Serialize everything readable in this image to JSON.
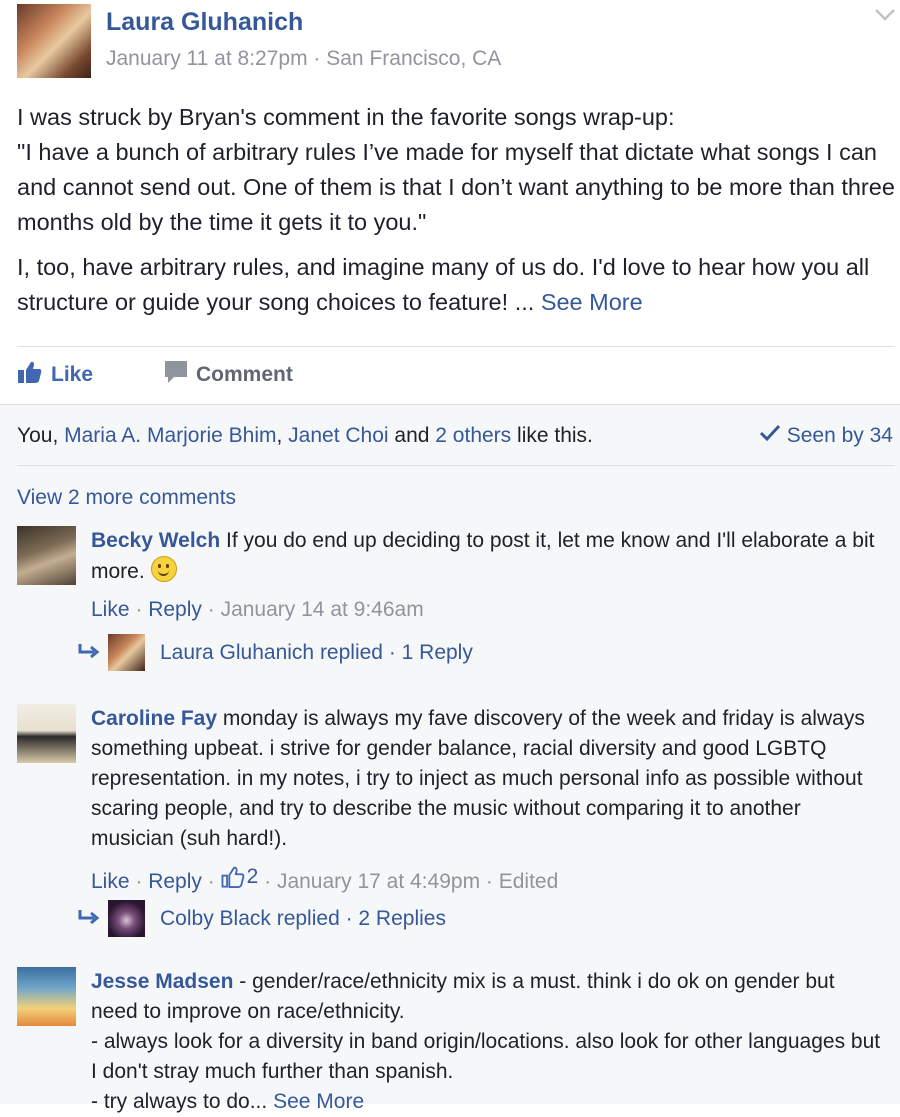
{
  "post": {
    "author": "Laura Gluhanich",
    "date": "January 11 at 8:27pm",
    "separator": " · ",
    "location": "San Francisco, CA",
    "paragraph1": {
      "line1": "I was struck by Bryan's comment in the favorite songs wrap-up:",
      "line2": "\"I have a bunch of arbitrary rules I’ve made for myself that dictate what songs I can and cannot send out. One of them is that I don’t want anything to be more than three months old by the time it gets it to you.\""
    },
    "paragraph2": "I, too, have arbitrary rules, and imagine many of us do. I'd love to hear how you all structure or guide your song choices to feature! ...",
    "see_more": "See More"
  },
  "actions": {
    "like": "Like",
    "comment": "Comment"
  },
  "likes": {
    "you": "You, ",
    "person1": "Maria A. Marjorie Bhim",
    "comma": ", ",
    "person2": "Janet Choi",
    "and": " and ",
    "others": "2 others",
    "suffix": " like this.",
    "seen_by": "Seen by 34"
  },
  "view_more": "View 2 more comments",
  "comments": [
    {
      "name": "Becky Welch",
      "text": " If you do end up deciding to post it, let me know and I'll elaborate a bit more.",
      "like": "Like",
      "reply": "Reply",
      "date": "January 14 at 9:46am",
      "reply_summary": "Laura Gluhanich replied · 1 Reply"
    },
    {
      "name": "Caroline Fay",
      "text": " monday is always my fave discovery of the week and friday is always something upbeat. i strive for gender balance, racial diversity and good LGBTQ representation. in my notes, i try to inject as much personal info as possible without scaring people, and try to describe the music without comparing it to another musician (suh hard!).",
      "like": "Like",
      "reply": "Reply",
      "like_count": "2",
      "date": "January 17 at 4:49pm",
      "edited": "Edited",
      "reply_summary": "Colby Black replied · 2 Replies"
    },
    {
      "name": "Jesse Madsen",
      "line1": " - gender/race/ethnicity mix is a must. think i do ok on gender but need to improve on race/ethnicity.",
      "line2": "- always look for a diversity in band origin/locations. also look for other languages but I don't stray much further than spanish.",
      "line3": "- try always to do...",
      "see_more": "See More"
    }
  ],
  "colors": {
    "link": "#365899",
    "like_blue": "#4267b2",
    "meta_gray": "#90949c",
    "feedback_bg": "#f6f7f9"
  }
}
